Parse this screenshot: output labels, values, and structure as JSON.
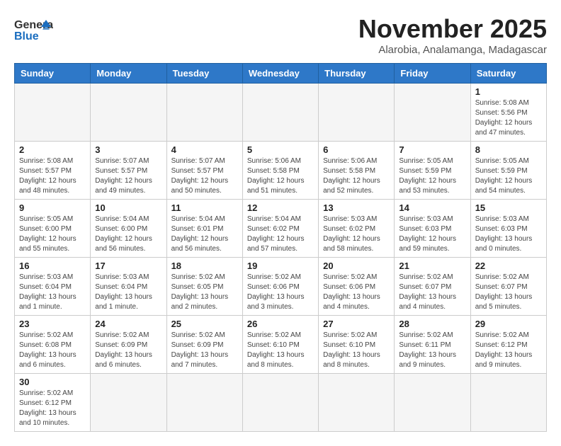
{
  "header": {
    "logo_general": "General",
    "logo_blue": "Blue",
    "month_title": "November 2025",
    "subtitle": "Alarobia, Analamanga, Madagascar"
  },
  "weekdays": [
    "Sunday",
    "Monday",
    "Tuesday",
    "Wednesday",
    "Thursday",
    "Friday",
    "Saturday"
  ],
  "weeks": [
    [
      {
        "day": "",
        "info": ""
      },
      {
        "day": "",
        "info": ""
      },
      {
        "day": "",
        "info": ""
      },
      {
        "day": "",
        "info": ""
      },
      {
        "day": "",
        "info": ""
      },
      {
        "day": "",
        "info": ""
      },
      {
        "day": "1",
        "info": "Sunrise: 5:08 AM\nSunset: 5:56 PM\nDaylight: 12 hours\nand 47 minutes."
      }
    ],
    [
      {
        "day": "2",
        "info": "Sunrise: 5:08 AM\nSunset: 5:57 PM\nDaylight: 12 hours\nand 48 minutes."
      },
      {
        "day": "3",
        "info": "Sunrise: 5:07 AM\nSunset: 5:57 PM\nDaylight: 12 hours\nand 49 minutes."
      },
      {
        "day": "4",
        "info": "Sunrise: 5:07 AM\nSunset: 5:57 PM\nDaylight: 12 hours\nand 50 minutes."
      },
      {
        "day": "5",
        "info": "Sunrise: 5:06 AM\nSunset: 5:58 PM\nDaylight: 12 hours\nand 51 minutes."
      },
      {
        "day": "6",
        "info": "Sunrise: 5:06 AM\nSunset: 5:58 PM\nDaylight: 12 hours\nand 52 minutes."
      },
      {
        "day": "7",
        "info": "Sunrise: 5:05 AM\nSunset: 5:59 PM\nDaylight: 12 hours\nand 53 minutes."
      },
      {
        "day": "8",
        "info": "Sunrise: 5:05 AM\nSunset: 5:59 PM\nDaylight: 12 hours\nand 54 minutes."
      }
    ],
    [
      {
        "day": "9",
        "info": "Sunrise: 5:05 AM\nSunset: 6:00 PM\nDaylight: 12 hours\nand 55 minutes."
      },
      {
        "day": "10",
        "info": "Sunrise: 5:04 AM\nSunset: 6:00 PM\nDaylight: 12 hours\nand 56 minutes."
      },
      {
        "day": "11",
        "info": "Sunrise: 5:04 AM\nSunset: 6:01 PM\nDaylight: 12 hours\nand 56 minutes."
      },
      {
        "day": "12",
        "info": "Sunrise: 5:04 AM\nSunset: 6:02 PM\nDaylight: 12 hours\nand 57 minutes."
      },
      {
        "day": "13",
        "info": "Sunrise: 5:03 AM\nSunset: 6:02 PM\nDaylight: 12 hours\nand 58 minutes."
      },
      {
        "day": "14",
        "info": "Sunrise: 5:03 AM\nSunset: 6:03 PM\nDaylight: 12 hours\nand 59 minutes."
      },
      {
        "day": "15",
        "info": "Sunrise: 5:03 AM\nSunset: 6:03 PM\nDaylight: 13 hours\nand 0 minutes."
      }
    ],
    [
      {
        "day": "16",
        "info": "Sunrise: 5:03 AM\nSunset: 6:04 PM\nDaylight: 13 hours\nand 1 minute."
      },
      {
        "day": "17",
        "info": "Sunrise: 5:03 AM\nSunset: 6:04 PM\nDaylight: 13 hours\nand 1 minute."
      },
      {
        "day": "18",
        "info": "Sunrise: 5:02 AM\nSunset: 6:05 PM\nDaylight: 13 hours\nand 2 minutes."
      },
      {
        "day": "19",
        "info": "Sunrise: 5:02 AM\nSunset: 6:06 PM\nDaylight: 13 hours\nand 3 minutes."
      },
      {
        "day": "20",
        "info": "Sunrise: 5:02 AM\nSunset: 6:06 PM\nDaylight: 13 hours\nand 4 minutes."
      },
      {
        "day": "21",
        "info": "Sunrise: 5:02 AM\nSunset: 6:07 PM\nDaylight: 13 hours\nand 4 minutes."
      },
      {
        "day": "22",
        "info": "Sunrise: 5:02 AM\nSunset: 6:07 PM\nDaylight: 13 hours\nand 5 minutes."
      }
    ],
    [
      {
        "day": "23",
        "info": "Sunrise: 5:02 AM\nSunset: 6:08 PM\nDaylight: 13 hours\nand 6 minutes."
      },
      {
        "day": "24",
        "info": "Sunrise: 5:02 AM\nSunset: 6:09 PM\nDaylight: 13 hours\nand 6 minutes."
      },
      {
        "day": "25",
        "info": "Sunrise: 5:02 AM\nSunset: 6:09 PM\nDaylight: 13 hours\nand 7 minutes."
      },
      {
        "day": "26",
        "info": "Sunrise: 5:02 AM\nSunset: 6:10 PM\nDaylight: 13 hours\nand 8 minutes."
      },
      {
        "day": "27",
        "info": "Sunrise: 5:02 AM\nSunset: 6:10 PM\nDaylight: 13 hours\nand 8 minutes."
      },
      {
        "day": "28",
        "info": "Sunrise: 5:02 AM\nSunset: 6:11 PM\nDaylight: 13 hours\nand 9 minutes."
      },
      {
        "day": "29",
        "info": "Sunrise: 5:02 AM\nSunset: 6:12 PM\nDaylight: 13 hours\nand 9 minutes."
      }
    ],
    [
      {
        "day": "30",
        "info": "Sunrise: 5:02 AM\nSunset: 6:12 PM\nDaylight: 13 hours\nand 10 minutes."
      },
      {
        "day": "",
        "info": ""
      },
      {
        "day": "",
        "info": ""
      },
      {
        "day": "",
        "info": ""
      },
      {
        "day": "",
        "info": ""
      },
      {
        "day": "",
        "info": ""
      },
      {
        "day": "",
        "info": ""
      }
    ]
  ]
}
